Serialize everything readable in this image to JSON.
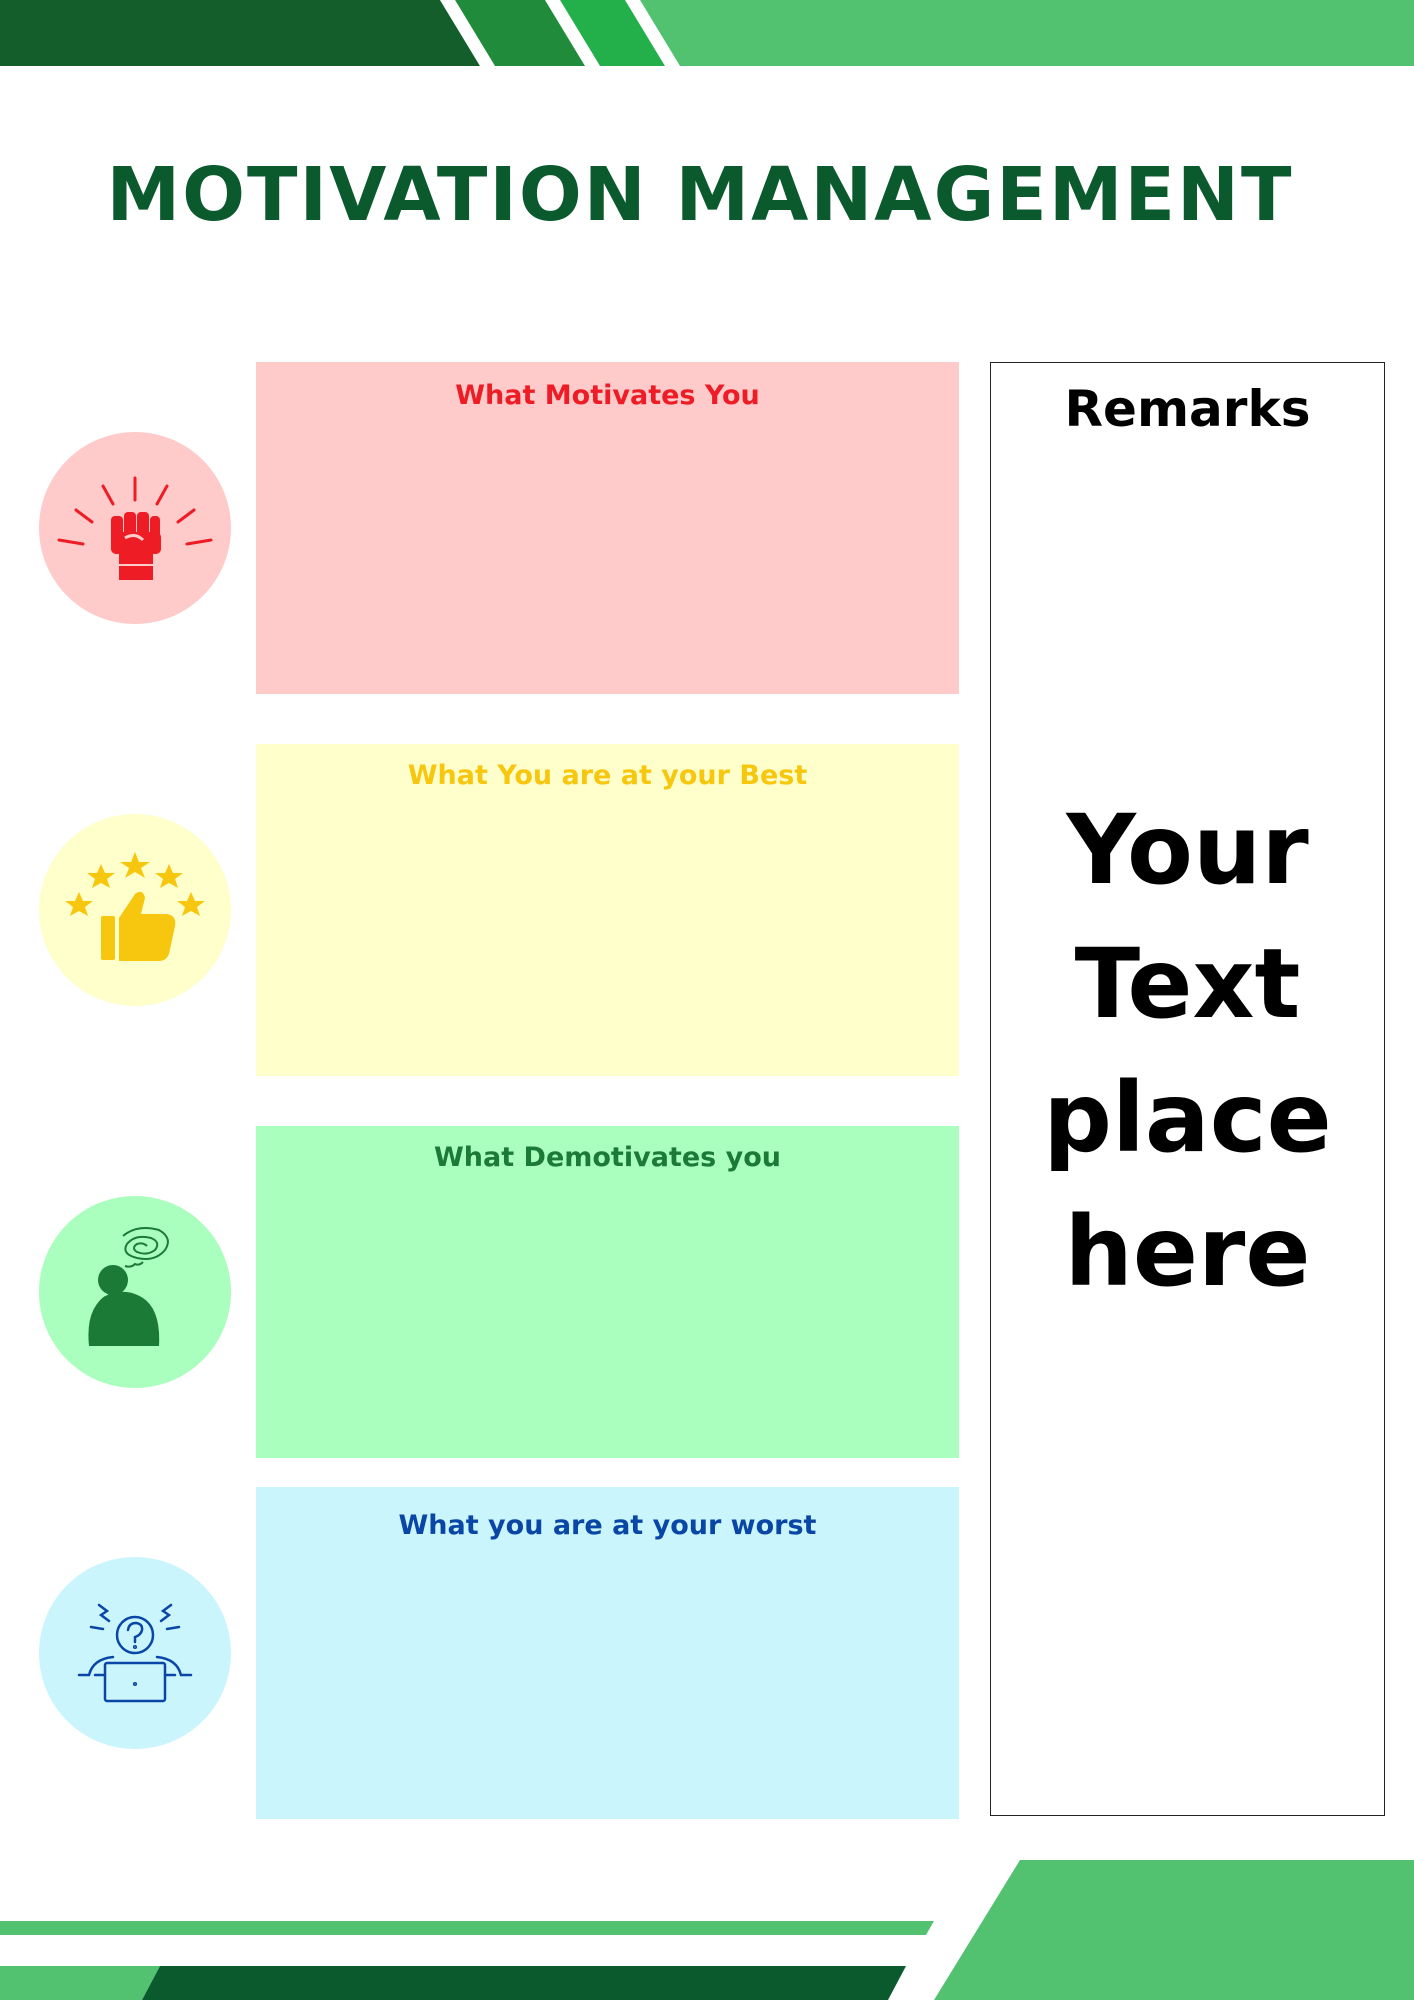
{
  "title": "MOTIVATION MANAGEMENT",
  "colors": {
    "dark_green": "#135e2b",
    "mid_green": "#1f8b3b",
    "bright_green": "#23b04b",
    "light_green": "#52c270",
    "title_green": "#0b5a2d"
  },
  "sections": [
    {
      "label": "What Motivates You",
      "text_color": "#ee1c25",
      "bg_color": "#ffcaca",
      "circle_color": "#ffcaca",
      "icon": "raised-fist-icon"
    },
    {
      "label": "What You are at your Best",
      "text_color": "#f7c70f",
      "bg_color": "#feffcb",
      "circle_color": "#feffcb",
      "icon": "thumbs-up-stars-icon"
    },
    {
      "label": "What Demotivates you",
      "text_color": "#1a7a36",
      "bg_color": "#aaffbe",
      "circle_color": "#aaffbe",
      "icon": "frustrated-person-icon"
    },
    {
      "label": "What you are at your worst",
      "text_color": "#0a46a6",
      "bg_color": "#caf5fd",
      "circle_color": "#caf5fd",
      "icon": "confused-person-laptop-icon"
    }
  ],
  "remarks": {
    "title": "Remarks",
    "body_lines": [
      "Your",
      "Text",
      "place",
      "here"
    ]
  }
}
